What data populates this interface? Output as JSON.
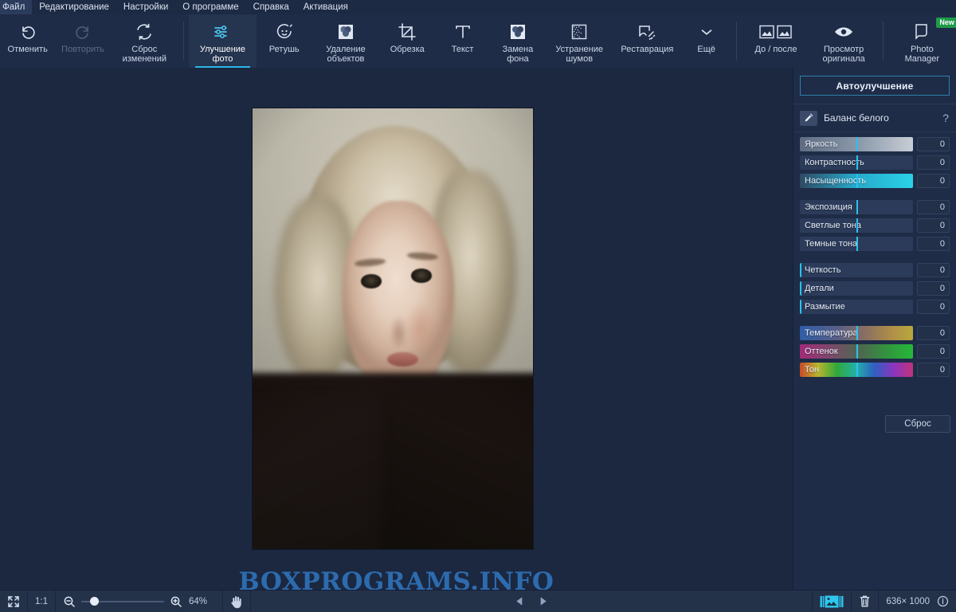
{
  "menubar": {
    "items": [
      {
        "label": "Файл",
        "name": "menu-file"
      },
      {
        "label": "Редактирование",
        "name": "menu-edit"
      },
      {
        "label": "Настройки",
        "name": "menu-settings"
      },
      {
        "label": "О программе",
        "name": "menu-about"
      },
      {
        "label": "Справка",
        "name": "menu-help"
      },
      {
        "label": "Активация",
        "name": "menu-activation"
      }
    ]
  },
  "toolbar": {
    "undo": {
      "label": "Отменить",
      "icon": "undo-icon",
      "enabled": true
    },
    "redo": {
      "label": "Повторить",
      "icon": "redo-icon",
      "enabled": false
    },
    "reset": {
      "label": "Сброс\nизменений",
      "icon": "reset-changes-icon"
    },
    "tools": [
      {
        "label": "Улучшение\nфото",
        "icon": "adjust-sliders-icon",
        "active": true
      },
      {
        "label": "Ретушь",
        "icon": "retouch-face-icon",
        "active": false
      },
      {
        "label": "Удаление\nобъектов",
        "icon": "object-removal-icon",
        "active": false
      },
      {
        "label": "Обрезка",
        "icon": "crop-icon",
        "active": false
      },
      {
        "label": "Текст",
        "icon": "text-icon",
        "active": false
      },
      {
        "label": "Замена\nфона",
        "icon": "background-replace-icon",
        "active": false
      },
      {
        "label": "Устранение\nшумов",
        "icon": "noise-removal-icon",
        "active": false
      },
      {
        "label": "Реставрация",
        "icon": "restoration-icon",
        "active": false
      }
    ],
    "more": {
      "label": "Ещё",
      "icon": "chevron-down-icon"
    },
    "before_after": {
      "label": "До / после",
      "icon": "before-after-icon"
    },
    "view_original": {
      "label": "Просмотр\nоригинала",
      "icon": "eye-icon"
    },
    "photo_manager": {
      "label": "Photo\nManager",
      "icon": "photo-manager-icon",
      "badge": "New"
    }
  },
  "panel": {
    "auto_enhance": "Автоулучшение",
    "white_balance": {
      "label": "Баланс белого",
      "icon": "eyedropper-icon",
      "help": "?"
    },
    "reset": "Сброс",
    "slider_groups": [
      {
        "sliders": [
          {
            "label": "Яркость",
            "value": "0",
            "fill": "g-bright",
            "handle_pct": 50
          },
          {
            "label": "Контрастность",
            "value": "0",
            "fill": "g-contrast",
            "handle_pct": 50
          },
          {
            "label": "Насыщенность",
            "value": "0",
            "fill": "g-sat",
            "handle_pct": 50
          }
        ]
      },
      {
        "sliders": [
          {
            "label": "Экспозиция",
            "value": "0",
            "fill": "g-plain",
            "handle_pct": 50
          },
          {
            "label": "Светлые тона",
            "value": "0",
            "fill": "g-plain",
            "handle_pct": 50
          },
          {
            "label": "Темные тона",
            "value": "0",
            "fill": "g-plain",
            "handle_pct": 50
          }
        ]
      },
      {
        "sliders": [
          {
            "label": "Четкость",
            "value": "0",
            "fill": "g-plain",
            "handle_pct": 0
          },
          {
            "label": "Детали",
            "value": "0",
            "fill": "g-plain",
            "handle_pct": 0
          },
          {
            "label": "Размытие",
            "value": "0",
            "fill": "g-plain",
            "handle_pct": 0
          }
        ]
      },
      {
        "sliders": [
          {
            "label": "Температура",
            "value": "0",
            "fill": "g-temp",
            "handle_pct": 50
          },
          {
            "label": "Оттенок",
            "value": "0",
            "fill": "g-tint",
            "handle_pct": 50
          },
          {
            "label": "Тон",
            "value": "0",
            "fill": "g-hue",
            "handle_pct": 50
          }
        ]
      }
    ]
  },
  "canvas": {
    "watermark": "BOXPROGRAMS.INFO"
  },
  "statusbar": {
    "fit_icon": "fit-to-screen-icon",
    "actual_size": "1:1",
    "zoom_out_icon": "zoom-out-icon",
    "zoom_in_icon": "zoom-in-icon",
    "zoom_level": "64%",
    "hand_icon": "hand-tool-icon",
    "prev_icon": "previous-image-icon",
    "next_icon": "next-image-icon",
    "filmstrip_icon": "filmstrip-toggle-icon",
    "delete_icon": "trash-icon",
    "dimensions": "636× 1000",
    "info_icon": "info-icon"
  },
  "colors": {
    "accent": "#2bb6e8",
    "panel_bg": "#1f2c47",
    "canvas_bg": "#1b2840",
    "badge_green": "#1f9b4a",
    "watermark_blue": "#2f6fb5"
  }
}
